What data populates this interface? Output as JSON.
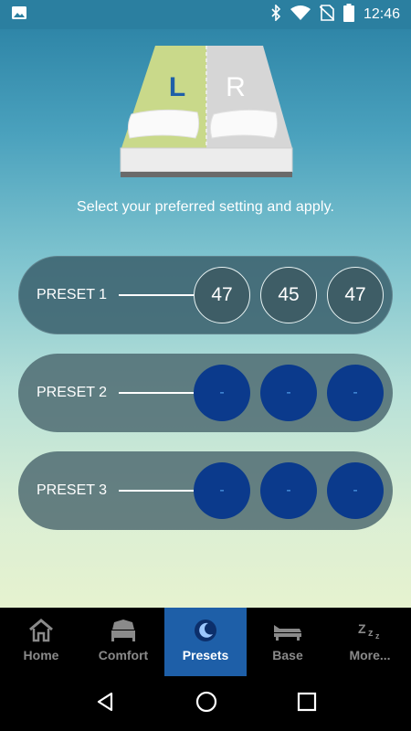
{
  "status_bar": {
    "time": "12:46",
    "icons": [
      "image-icon",
      "bluetooth-icon",
      "wifi-icon",
      "no-sim-icon",
      "battery-icon"
    ]
  },
  "bed": {
    "left_label": "L",
    "right_label": "R"
  },
  "instruction": "Select your preferred setting and apply.",
  "presets": [
    {
      "label": "PRESET 1",
      "values": [
        "47",
        "45",
        "47"
      ],
      "state": "set"
    },
    {
      "label": "PRESET 2",
      "values": [
        "-",
        "-",
        "-"
      ],
      "state": "empty"
    },
    {
      "label": "PRESET 3",
      "values": [
        "-",
        "-",
        "-"
      ],
      "state": "empty"
    }
  ],
  "tabs": [
    {
      "label": "Home",
      "icon": "home-icon"
    },
    {
      "label": "Comfort",
      "icon": "bed-comfort-icon"
    },
    {
      "label": "Presets",
      "icon": "moon-icon",
      "active": true
    },
    {
      "label": "Base",
      "icon": "adjustable-base-icon"
    },
    {
      "label": "More...",
      "icon": "sleep-zzz-icon"
    }
  ],
  "nav": [
    "back-icon",
    "home-circle-icon",
    "recents-icon"
  ],
  "colors": {
    "status_bar": "#2b7fa0",
    "active_tab": "#1e5fa8",
    "empty_circle": "#0b3a8c",
    "filled_circle": "#3e5d66"
  }
}
